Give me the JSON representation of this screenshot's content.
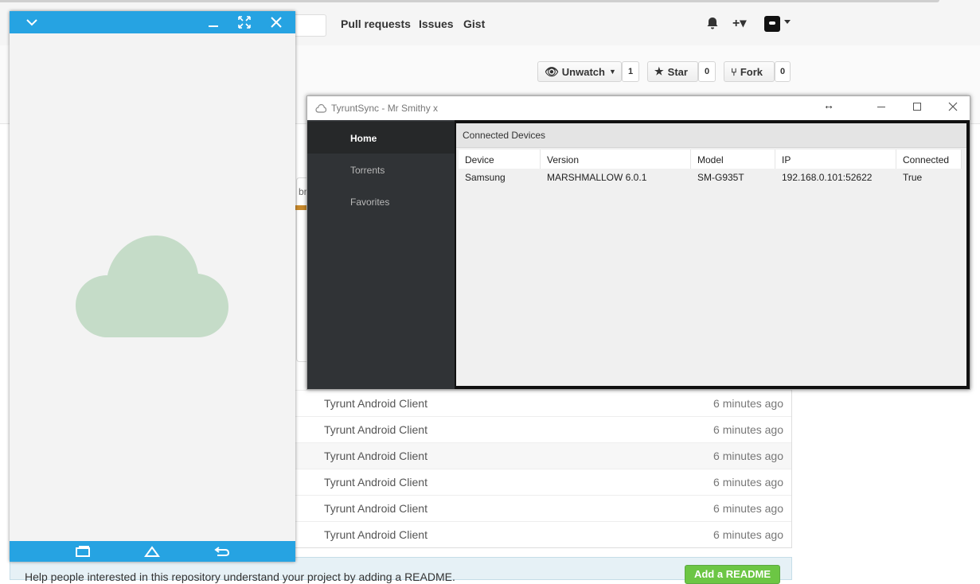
{
  "github": {
    "nav": [
      "Pull requests",
      "Issues",
      "Gist"
    ],
    "plus_icon": "+▾",
    "buttons": {
      "unwatch_label": "Unwatch",
      "unwatch_count": "1",
      "star_label": "Star",
      "star_count": "0",
      "fork_label": "Fork",
      "fork_count": "0"
    },
    "fragment_text": "br",
    "files": [
      {
        "message": "Tyrunt Android Client",
        "age": "6 minutes ago"
      },
      {
        "message": "Tyrunt Android Client",
        "age": "6 minutes ago"
      },
      {
        "message": "Tyrunt Android Client",
        "age": "6 minutes ago"
      },
      {
        "message": "Tyrunt Android Client",
        "age": "6 minutes ago"
      },
      {
        "message": "Tyrunt Android Client",
        "age": "6 minutes ago"
      },
      {
        "message": "Tyrunt Android Client",
        "age": "6 minutes ago"
      }
    ],
    "readme_text": "Help people interested in this repository understand your project by adding a README.",
    "readme_button": "Add a README"
  },
  "phone": {
    "cloud_color": "#c5dcc8",
    "accent": "#26a3e2"
  },
  "tyruntsync": {
    "title": "TyruntSync - Mr Smithy x",
    "sidebar": [
      "Home",
      "Torrents",
      "Favorites"
    ],
    "active_item": "Home",
    "panel_title": "Connected Devices",
    "columns": [
      "Device",
      "Version",
      "Model",
      "IP",
      "Connected"
    ],
    "rows": [
      [
        "Samsung",
        "MARSHMALLOW 6.0.1",
        "SM-G935T",
        "192.168.0.101:52622",
        "True"
      ]
    ]
  }
}
